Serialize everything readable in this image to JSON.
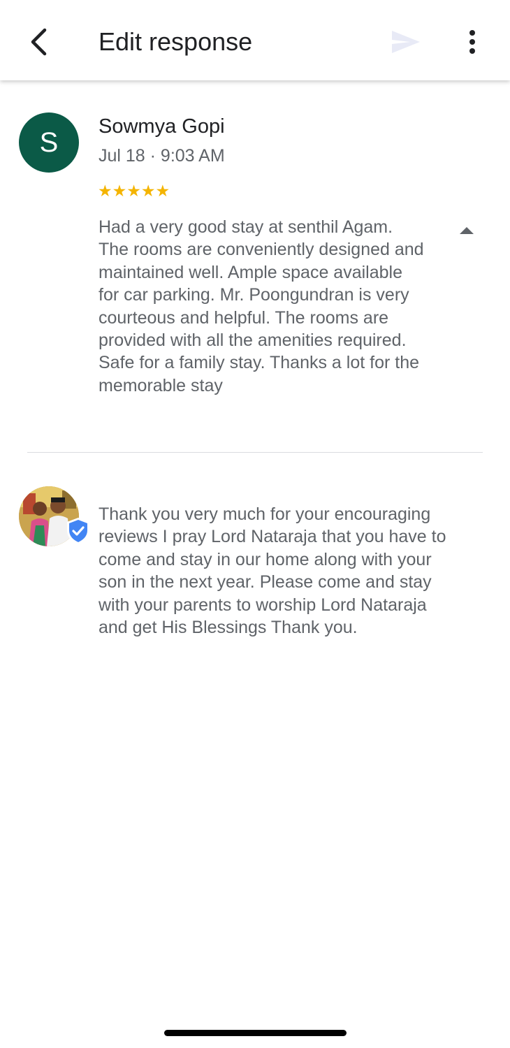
{
  "header": {
    "title": "Edit response",
    "back_icon": "chevron-left-icon",
    "send_icon": "send-icon",
    "more_icon": "more-vert-icon"
  },
  "review": {
    "avatar_letter": "S",
    "avatar_color": "#0b5a47",
    "reviewer_name": "Sowmya Gopi",
    "time": "Jul 18 · 9:03 AM",
    "rating": 5,
    "stars": "★★★★★",
    "text": "Had a very good stay at senthil Agam. The rooms are conveniently designed and maintained well. Ample space available for car parking. Mr. Poongundran is very courteous and helpful. The rooms are provided with all the amenities required. Safe for a family stay. Thanks a lot for the memorable stay"
  },
  "reply": {
    "verified_icon": "verified-shield-icon",
    "text": "Thank you very much for your encouraging reviews I pray Lord Nataraja that you have to come and stay in our home along with your son in the next year. Please come and stay with your parents to worship Lord Nataraja and get His Blessings Thank you."
  },
  "colors": {
    "star": "#f4b400",
    "verified_badge": "#4285f4",
    "secondary_text": "#5f6368"
  }
}
